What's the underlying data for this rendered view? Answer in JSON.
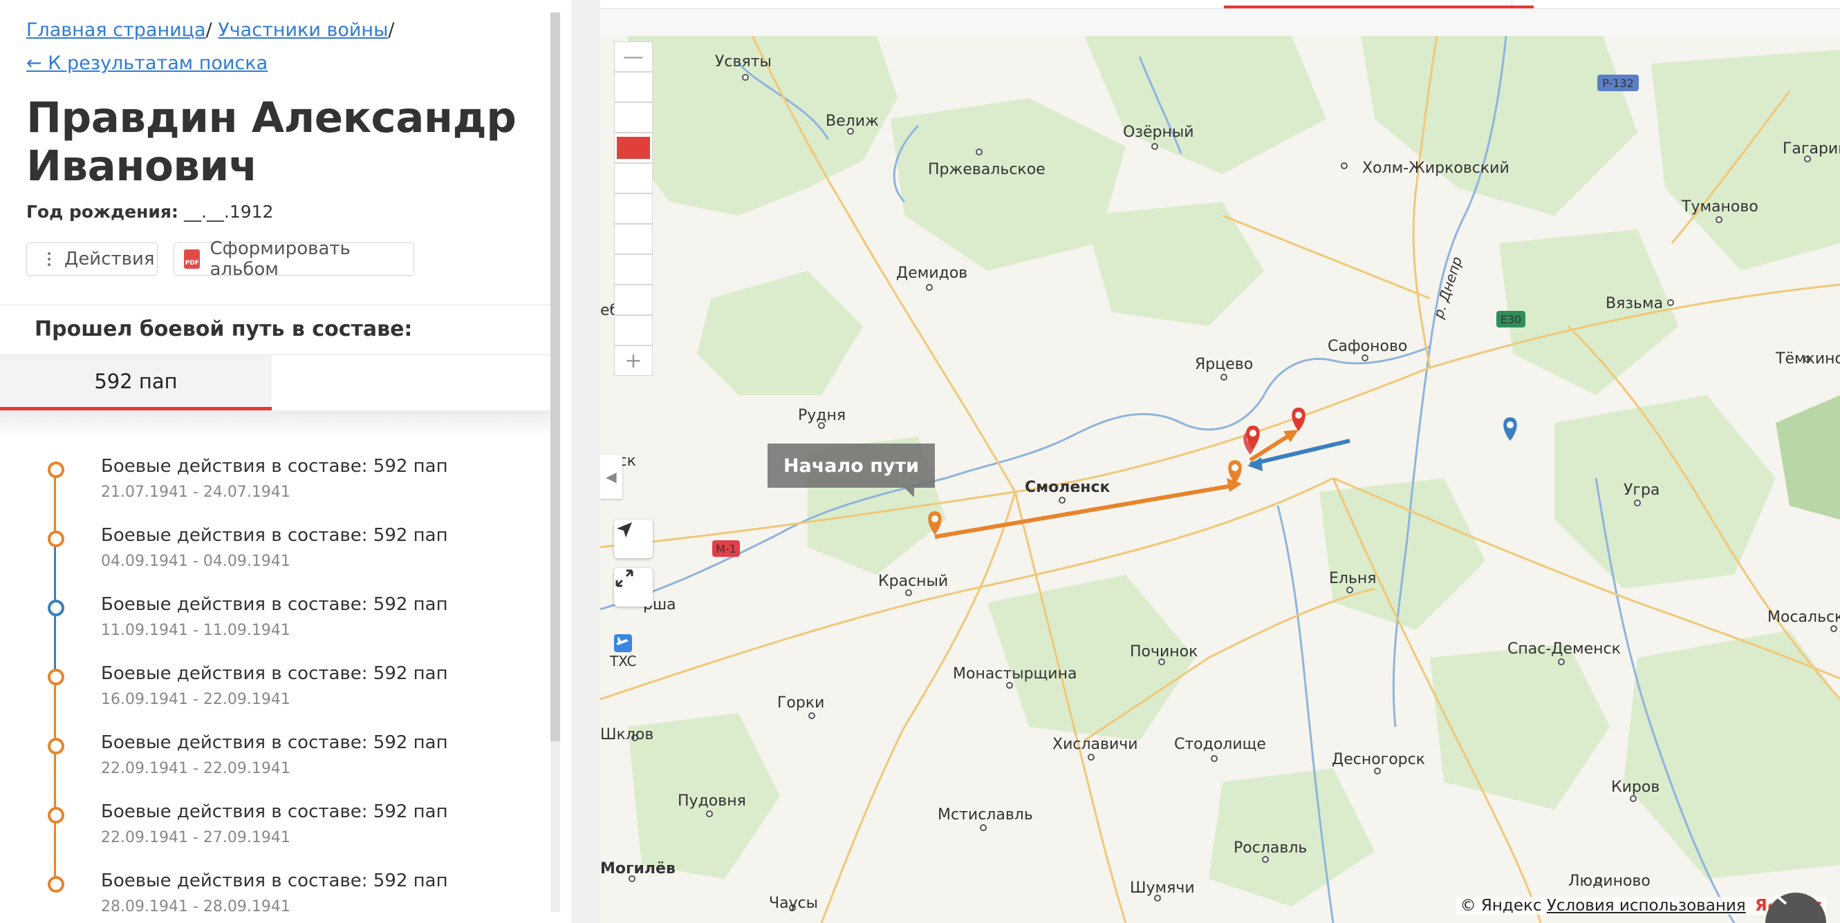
{
  "breadcrumbs": {
    "home": "Главная страница",
    "sep1": "/ ",
    "participants": "Участники войны",
    "sep2": "/"
  },
  "back_link": "← К результатам поиска",
  "person": {
    "name": "Правдин Александр Иванович",
    "birth_label": "Год рождения:",
    "birth_value": "__.__.1912"
  },
  "buttons": {
    "actions": "Действия",
    "album": "Сформировать альбом",
    "pdf_icon_text": "PDF"
  },
  "section_title": "Прошел боевой путь в составе:",
  "unit_tab": "592 пап",
  "timeline": [
    {
      "title": "Боевые действия в составе: 592 пап",
      "dates": "21.07.1941 - 24.07.1941",
      "color": "orange"
    },
    {
      "title": "Боевые действия в составе: 592 пап",
      "dates": "04.09.1941 - 04.09.1941",
      "color": "orange"
    },
    {
      "title": "Боевые действия в составе: 592 пап",
      "dates": "11.09.1941 - 11.09.1941",
      "color": "blue"
    },
    {
      "title": "Боевые действия в составе: 592 пап",
      "dates": "16.09.1941 - 22.09.1941",
      "color": "orange"
    },
    {
      "title": "Боевые действия в составе: 592 пап",
      "dates": "22.09.1941 - 22.09.1941",
      "color": "orange"
    },
    {
      "title": "Боевые действия в составе: 592 пап",
      "dates": "22.09.1941 - 27.09.1941",
      "color": "orange"
    },
    {
      "title": "Боевые действия в составе: 592 пап",
      "dates": "28.09.1941 - 28.09.1941",
      "color": "orange"
    }
  ],
  "map": {
    "tooltip": "Начало пути",
    "copyright": "© Яндекс",
    "terms": "Условия использования",
    "yandex": "Яндекс",
    "airport_label": "TXC",
    "route_signs": {
      "m1": "M-1",
      "e30": "E30",
      "r132": "P-132"
    },
    "river_label": "р. Днепр",
    "cities": {
      "usvyaty": "Усвяты",
      "velizh": "Велиж",
      "ozerny": "Озёрный",
      "przhevalskoe": "Пржевальское",
      "kholm": "Холм-Жирковский",
      "gagarin": "Гагарин",
      "tumanovo": "Туманово",
      "demidov": "Демидов",
      "vyazma": "Вязьма",
      "temkino": "Тёмкино",
      "yartsevo": "Ярцево",
      "safonovo": "Сафоново",
      "rudnya": "Рудня",
      "smolensk": "Смоленск",
      "ugra": "Угра",
      "krasny": "Красный",
      "elnya": "Ельня",
      "pochinok": "Починок",
      "spasdemensk": "Спас-Деменск",
      "mosalsk": "Мосальск",
      "monastyrshchina": "Монастырщина",
      "gorki": "Горки",
      "shklov": "Шклов",
      "khislavichi": "Хиславичи",
      "stodolishche": "Стодолище",
      "desnogorsk": "Десногорск",
      "kirov": "Киров",
      "pudovnya": "Пудовня",
      "mstislavl": "Мстиславль",
      "mogilev": "Могилёв",
      "roslavl": "Рославль",
      "shumyachi": "Шумячи",
      "lyudinovo": "Людиново",
      "chausy": "Чаусы",
      "orsha": "рша",
      "vitebsk": "ебск",
      "nevsk": "евск"
    }
  },
  "colors": {
    "accent": "#e53935",
    "orange": "#e8832b",
    "blue": "#3a7fbf",
    "link": "#2f7bd6"
  },
  "icons": [
    "dots-icon",
    "pdf-icon",
    "arrow-icon",
    "fullscreen-icon",
    "airport-icon",
    "chevron-up-icon",
    "pin-icon"
  ]
}
